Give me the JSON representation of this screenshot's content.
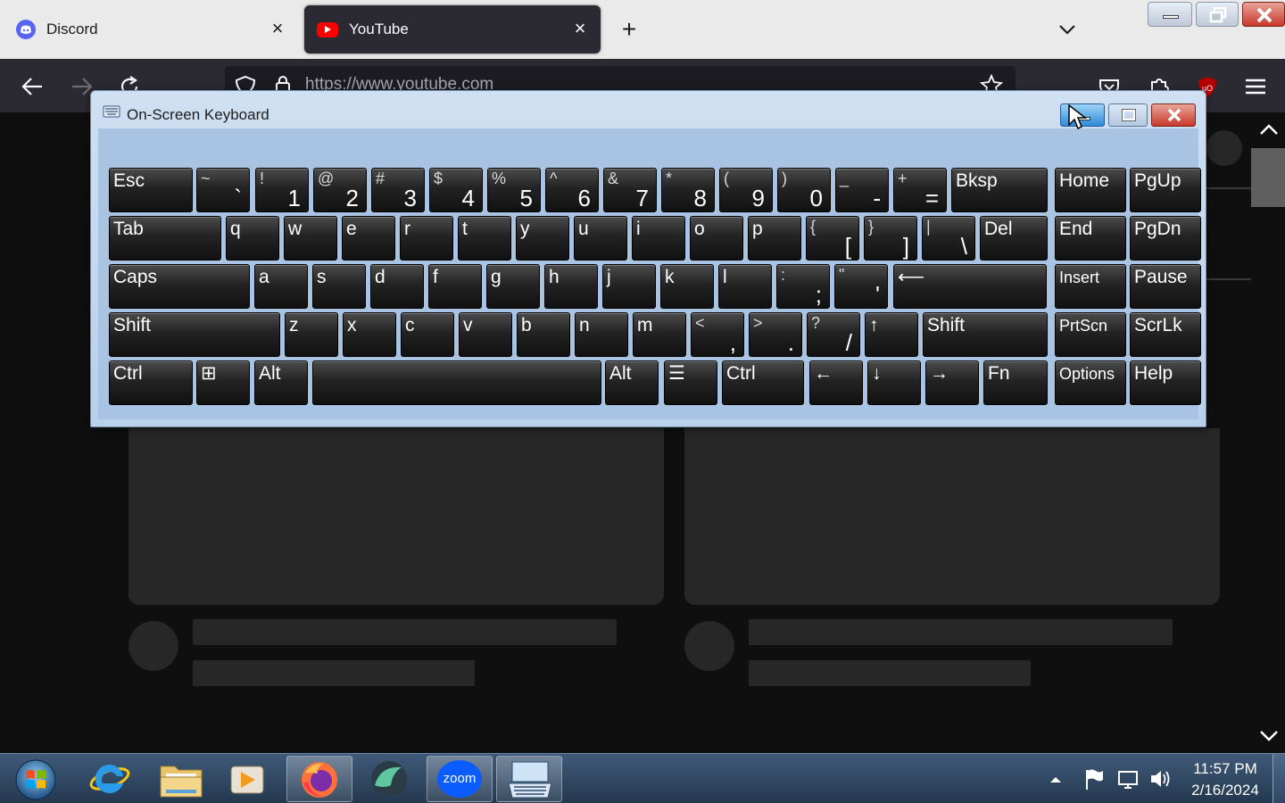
{
  "browser": {
    "tabs": [
      {
        "title": "Discord",
        "active": false
      },
      {
        "title": "YouTube",
        "active": true
      }
    ],
    "url": "https://www.youtube.com"
  },
  "osk": {
    "title": "On-Screen Keyboard",
    "rows": [
      [
        {
          "label": "Esc"
        },
        {
          "top": "~",
          "bottom": "`"
        },
        {
          "top": "!",
          "bottom": "1"
        },
        {
          "top": "@",
          "bottom": "2"
        },
        {
          "top": "#",
          "bottom": "3"
        },
        {
          "top": "$",
          "bottom": "4"
        },
        {
          "top": "%",
          "bottom": "5"
        },
        {
          "top": "^",
          "bottom": "6"
        },
        {
          "top": "&",
          "bottom": "7"
        },
        {
          "top": "*",
          "bottom": "8"
        },
        {
          "top": "(",
          "bottom": "9"
        },
        {
          "top": ")",
          "bottom": "0"
        },
        {
          "top": "_",
          "bottom": "-"
        },
        {
          "top": "+",
          "bottom": "="
        },
        {
          "label": "Bksp"
        },
        {
          "label": "Home"
        },
        {
          "label": "PgUp"
        }
      ],
      [
        {
          "label": "Tab"
        },
        {
          "label": "q"
        },
        {
          "label": "w"
        },
        {
          "label": "e"
        },
        {
          "label": "r"
        },
        {
          "label": "t"
        },
        {
          "label": "y"
        },
        {
          "label": "u"
        },
        {
          "label": "i"
        },
        {
          "label": "o"
        },
        {
          "label": "p"
        },
        {
          "top": "{",
          "bottom": "["
        },
        {
          "top": "}",
          "bottom": "]"
        },
        {
          "top": "|",
          "bottom": "\\"
        },
        {
          "label": "Del"
        },
        {
          "label": "End"
        },
        {
          "label": "PgDn"
        }
      ],
      [
        {
          "label": "Caps"
        },
        {
          "label": "a"
        },
        {
          "label": "s"
        },
        {
          "label": "d"
        },
        {
          "label": "f"
        },
        {
          "label": "g"
        },
        {
          "label": "h"
        },
        {
          "label": "j"
        },
        {
          "label": "k"
        },
        {
          "label": "l"
        },
        {
          "top": ":",
          "bottom": ";"
        },
        {
          "top": "\"",
          "bottom": "'"
        },
        {
          "label": "⟵"
        },
        {
          "label": "Insert"
        },
        {
          "label": "Pause"
        }
      ],
      [
        {
          "label": "Shift"
        },
        {
          "label": "z"
        },
        {
          "label": "x"
        },
        {
          "label": "c"
        },
        {
          "label": "v"
        },
        {
          "label": "b"
        },
        {
          "label": "n"
        },
        {
          "label": "m"
        },
        {
          "top": "<",
          "bottom": ","
        },
        {
          "top": ">",
          "bottom": "."
        },
        {
          "top": "?",
          "bottom": "/"
        },
        {
          "label": "↑"
        },
        {
          "label": "Shift"
        },
        {
          "label": "PrtScn"
        },
        {
          "label": "ScrLk"
        }
      ],
      [
        {
          "label": "Ctrl"
        },
        {
          "label": "⊞"
        },
        {
          "label": "Alt"
        },
        {
          "label": ""
        },
        {
          "label": "Alt"
        },
        {
          "label": "☰"
        },
        {
          "label": "Ctrl"
        },
        {
          "label": "←"
        },
        {
          "label": "↓"
        },
        {
          "label": "→"
        },
        {
          "label": "Fn"
        },
        {
          "label": "Options"
        },
        {
          "label": "Help"
        }
      ]
    ]
  },
  "taskbar": {
    "apps": [
      "start",
      "internet-explorer",
      "file-explorer",
      "media-player",
      "firefox",
      "app-orb",
      "zoom",
      "on-screen-keyboard"
    ],
    "zoom_label": "zoom",
    "time": "11:57 PM",
    "date": "2/16/2024"
  },
  "colors": {
    "youtube_red": "#ff0000",
    "discord_blurple": "#5865f2",
    "zoom_blue": "#0b5cff",
    "close_red": "#c8382c"
  }
}
